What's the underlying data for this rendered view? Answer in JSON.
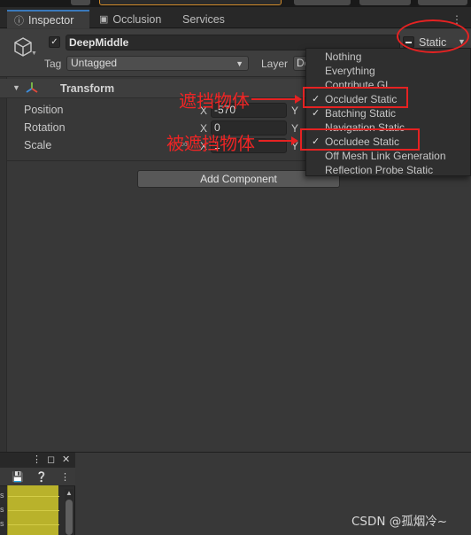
{
  "tabs": [
    {
      "label": "Inspector",
      "icon": "info-icon",
      "active": true
    },
    {
      "label": "Occlusion",
      "icon": "occlusion-icon",
      "active": false
    },
    {
      "label": "Services",
      "icon": "",
      "active": false
    }
  ],
  "tab_menu_label": "⋮",
  "object": {
    "active": true,
    "name": "DeepMiddle",
    "static_label": "Static",
    "tag_label": "Tag",
    "tag_value": "Untagged",
    "layer_label": "Layer",
    "layer_value": "De"
  },
  "transform": {
    "title": "Transform",
    "rows": [
      {
        "label": "Position",
        "x_axis": "X",
        "x_value": "-570",
        "y_axis": "Y"
      },
      {
        "label": "Rotation",
        "x_axis": "X",
        "x_value": "0",
        "y_axis": "Y"
      },
      {
        "label": "Scale",
        "x_axis": "X",
        "x_value": "1",
        "y_axis": "Y"
      }
    ]
  },
  "add_component_label": "Add Component",
  "static_menu": [
    {
      "label": "Nothing",
      "checked": false
    },
    {
      "label": "Everything",
      "checked": false
    },
    {
      "label": "Contribute GI",
      "checked": false
    },
    {
      "label": "Occluder Static",
      "checked": true
    },
    {
      "label": "Batching Static",
      "checked": true
    },
    {
      "label": "Navigation Static",
      "checked": false
    },
    {
      "label": "Occludee Static",
      "checked": true
    },
    {
      "label": "Off Mesh Link Generation",
      "checked": false
    },
    {
      "label": "Reflection Probe Static",
      "checked": false
    }
  ],
  "annotations": {
    "occluder": "遮挡物体",
    "occludee": "被遮挡物体",
    "color": "#e52222"
  },
  "small_panel": {
    "menu_label": "⋮",
    "chips": [
      "s",
      "s",
      "s"
    ]
  },
  "watermark": "CSDN @孤烟冷~",
  "colors": {
    "accent_tab": "#3a79bb",
    "panel": "#383838",
    "menu_bg": "#2f2f2f",
    "olive": "#b9b22b"
  }
}
